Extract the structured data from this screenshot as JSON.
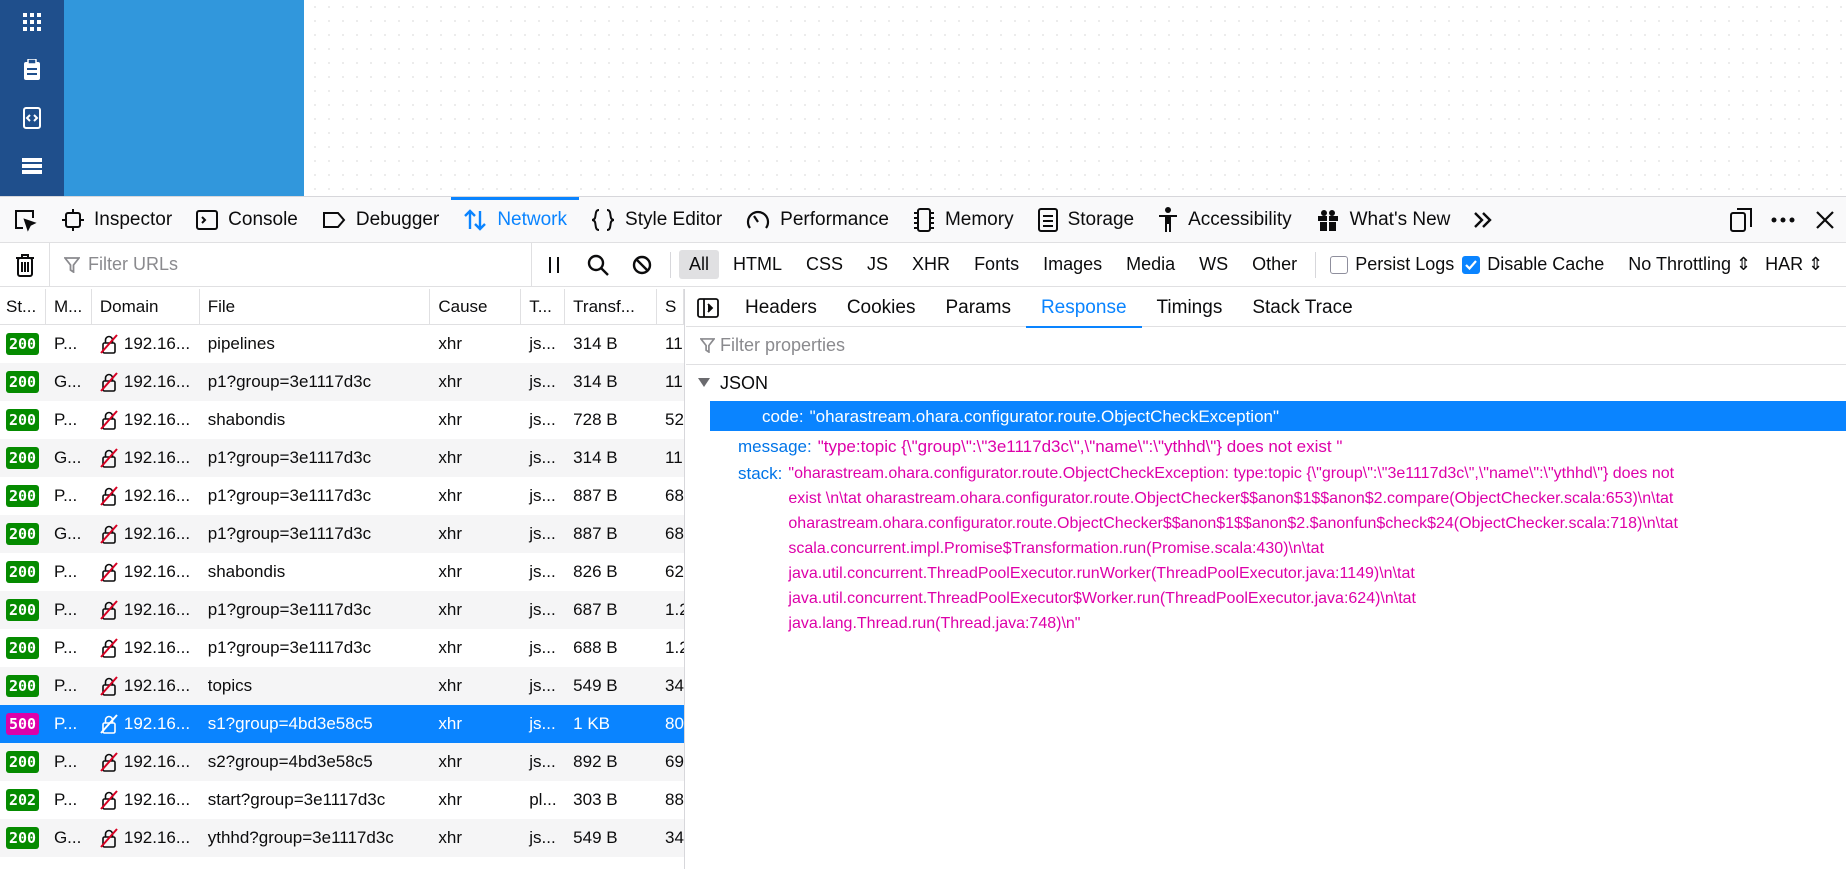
{
  "toolbox": {
    "tabs": [
      {
        "label": "Inspector",
        "icon": "inspector-icon"
      },
      {
        "label": "Console",
        "icon": "console-icon"
      },
      {
        "label": "Debugger",
        "icon": "debugger-icon"
      },
      {
        "label": "Network",
        "icon": "network-icon",
        "active": true
      },
      {
        "label": "Style Editor",
        "icon": "style-editor-icon"
      },
      {
        "label": "Performance",
        "icon": "performance-icon"
      },
      {
        "label": "Memory",
        "icon": "memory-icon"
      },
      {
        "label": "Storage",
        "icon": "storage-icon"
      },
      {
        "label": "Accessibility",
        "icon": "accessibility-icon"
      },
      {
        "label": "What's New",
        "icon": "whats-new-icon"
      }
    ]
  },
  "network": {
    "filter_placeholder": "Filter URLs",
    "types": [
      "All",
      "HTML",
      "CSS",
      "JS",
      "XHR",
      "Fonts",
      "Images",
      "Media",
      "WS",
      "Other"
    ],
    "active_type": "All",
    "persist_logs": "Persist Logs",
    "disable_cache": "Disable Cache",
    "throttling": "No Throttling",
    "har": "HAR"
  },
  "table": {
    "headers": [
      "St...",
      "M...",
      "Domain",
      "File",
      "Cause",
      "T...",
      "Transf...",
      "S"
    ],
    "rows": [
      {
        "status": "200",
        "method": "P...",
        "domain": "192.16...",
        "file": "pipelines",
        "cause": "xhr",
        "type": "js...",
        "transferred": "314 B",
        "size": "11"
      },
      {
        "status": "200",
        "method": "G...",
        "domain": "192.16...",
        "file": "p1?group=3e1117d3c",
        "cause": "xhr",
        "type": "js...",
        "transferred": "314 B",
        "size": "11"
      },
      {
        "status": "200",
        "method": "P...",
        "domain": "192.16...",
        "file": "shabondis",
        "cause": "xhr",
        "type": "js...",
        "transferred": "728 B",
        "size": "52"
      },
      {
        "status": "200",
        "method": "G...",
        "domain": "192.16...",
        "file": "p1?group=3e1117d3c",
        "cause": "xhr",
        "type": "js...",
        "transferred": "314 B",
        "size": "11"
      },
      {
        "status": "200",
        "method": "P...",
        "domain": "192.16...",
        "file": "p1?group=3e1117d3c",
        "cause": "xhr",
        "type": "js...",
        "transferred": "887 B",
        "size": "68"
      },
      {
        "status": "200",
        "method": "G...",
        "domain": "192.16...",
        "file": "p1?group=3e1117d3c",
        "cause": "xhr",
        "type": "js...",
        "transferred": "887 B",
        "size": "68"
      },
      {
        "status": "200",
        "method": "P...",
        "domain": "192.16...",
        "file": "shabondis",
        "cause": "xhr",
        "type": "js...",
        "transferred": "826 B",
        "size": "62"
      },
      {
        "status": "200",
        "method": "P...",
        "domain": "192.16...",
        "file": "p1?group=3e1117d3c",
        "cause": "xhr",
        "type": "js...",
        "transferred": "687 B",
        "size": "1.2"
      },
      {
        "status": "200",
        "method": "P...",
        "domain": "192.16...",
        "file": "p1?group=3e1117d3c",
        "cause": "xhr",
        "type": "js...",
        "transferred": "688 B",
        "size": "1.2"
      },
      {
        "status": "200",
        "method": "P...",
        "domain": "192.16...",
        "file": "topics",
        "cause": "xhr",
        "type": "js...",
        "transferred": "549 B",
        "size": "34"
      },
      {
        "status": "500",
        "method": "P...",
        "domain": "192.16...",
        "file": "s1?group=4bd3e58c5",
        "cause": "xhr",
        "type": "js...",
        "transferred": "1 KB",
        "size": "80",
        "selected": true
      },
      {
        "status": "200",
        "method": "P...",
        "domain": "192.16...",
        "file": "s2?group=4bd3e58c5",
        "cause": "xhr",
        "type": "js...",
        "transferred": "892 B",
        "size": "69"
      },
      {
        "status": "202",
        "method": "P...",
        "domain": "192.16...",
        "file": "start?group=3e1117d3c",
        "cause": "xhr",
        "type": "pl...",
        "transferred": "303 B",
        "size": "88"
      },
      {
        "status": "200",
        "method": "G...",
        "domain": "192.16...",
        "file": "ythhd?group=3e1117d3c",
        "cause": "xhr",
        "type": "js...",
        "transferred": "549 B",
        "size": "34"
      }
    ]
  },
  "panel": {
    "tabs": [
      "Headers",
      "Cookies",
      "Params",
      "Response",
      "Timings",
      "Stack Trace"
    ],
    "active_tab": "Response",
    "filter_placeholder": "Filter properties",
    "json_label": "JSON",
    "code_key": "code:",
    "code_val": "\"oharastream.ohara.configurator.route.ObjectCheckException\"",
    "message_key": "message:",
    "message_val": "\"type:topic {\\\"group\\\":\\\"3e1117d3c\\\",\\\"name\\\":\\\"ythhd\\\"} does not exist \"",
    "stack_key": "stack:",
    "stack_lines": [
      "\"oharastream.ohara.configurator.route.ObjectCheckException: type:topic {\\\"group\\\":\\\"3e1117d3c\\\",\\\"name\\\":\\\"ythhd\\\"} does not",
      "exist \\n\\tat oharastream.ohara.configurator.route.ObjectChecker$$anon$1$$anon$2.compare(ObjectChecker.scala:653)\\n\\tat",
      "oharastream.ohara.configurator.route.ObjectChecker$$anon$1$$anon$2.$anonfun$check$24(ObjectChecker.scala:718)\\n\\tat",
      "scala.concurrent.impl.Promise$Transformation.run(Promise.scala:430)\\n\\tat",
      "java.util.concurrent.ThreadPoolExecutor.runWorker(ThreadPoolExecutor.java:1149)\\n\\tat",
      "java.util.concurrent.ThreadPoolExecutor$Worker.run(ThreadPoolExecutor.java:624)\\n\\tat",
      "java.lang.Thread.run(Thread.java:748)\\n\""
    ]
  },
  "colors": {
    "accent": "#0a84ff",
    "ok": "#058b00",
    "error": "#dd00a9",
    "app_nav": "#1f4f8c",
    "app_panel": "#3197dc"
  }
}
